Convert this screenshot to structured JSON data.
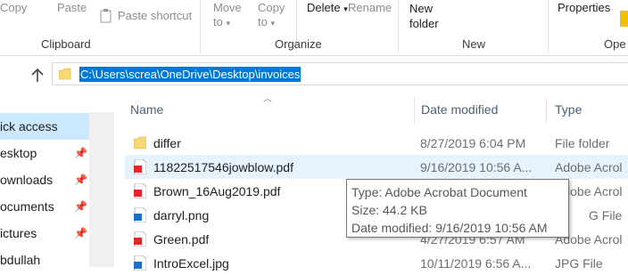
{
  "ribbon": {
    "copy": "Copy",
    "paste": "Paste",
    "paste_shortcut": "Paste shortcut",
    "move_to_1": "Move",
    "move_to_2": "to",
    "copy_to_1": "Copy",
    "copy_to_2": "to",
    "delete": "Delete",
    "rename": "Rename",
    "new_folder_1": "New",
    "new_folder_2": "folder",
    "properties": "Properties",
    "groups": {
      "clipboard": "Clipboard",
      "organize": "Organize",
      "new": "New",
      "open": "Ope"
    }
  },
  "address": {
    "path": "C:\\Users\\screa\\OneDrive\\Desktop\\invoices"
  },
  "nav": {
    "items": [
      {
        "label": "ick access",
        "pinned": false
      },
      {
        "label": "esktop",
        "pinned": true
      },
      {
        "label": "ownloads",
        "pinned": true
      },
      {
        "label": "ocuments",
        "pinned": true
      },
      {
        "label": "ictures",
        "pinned": true
      },
      {
        "label": "bdullah",
        "pinned": false
      }
    ]
  },
  "columns": {
    "name": "Name",
    "date_modified": "Date modified",
    "type": "Type"
  },
  "files": [
    {
      "name": "differ",
      "date": "8/27/2019 6:04 PM",
      "type": "File folder",
      "icon": "folder-icon"
    },
    {
      "name": "11822517546jowblow.pdf",
      "date": "9/16/2019 10:56 A...",
      "type": "Adobe Acrol",
      "icon": "pdf-icon"
    },
    {
      "name": "Brown_16Aug2019.pdf",
      "date": "",
      "type": "Adobe Acrol",
      "icon": "pdf-icon"
    },
    {
      "name": "darryl.png",
      "date": "",
      "type": "G File",
      "icon": "image-icon"
    },
    {
      "name": "Green.pdf",
      "date": "4/27/2019 6:57 AM",
      "type": "Adobe Acrol",
      "icon": "pdf-icon"
    },
    {
      "name": "IntroExcel.jpg",
      "date": "10/11/2019 6:56 A...",
      "type": "JPG File",
      "icon": "image-icon"
    }
  ],
  "tooltip": {
    "type_line": "Type: Adobe Acrobat Document",
    "size_line": "Size: 44.2 KB",
    "date_line": "Date modified: 9/16/2019 10:56 AM"
  },
  "colors": {
    "selection": "#0078d7",
    "nav_active": "#cce8ff",
    "row_hover": "#e5f3ff",
    "folder": "#f8d775",
    "pdf": "#e0282b"
  }
}
